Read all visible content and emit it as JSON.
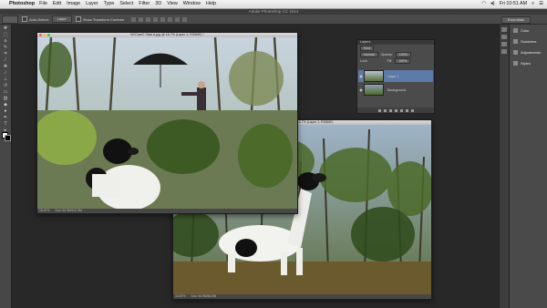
{
  "menubar": {
    "app": "Photoshop",
    "items": [
      "File",
      "Edit",
      "Image",
      "Layer",
      "Type",
      "Select",
      "Filter",
      "3D",
      "View",
      "Window",
      "Help"
    ],
    "clock": "Fri 10:51 AM"
  },
  "window_title": "Adobe Photoshop CC 2014",
  "options_bar": {
    "auto_select": "Auto-Select:",
    "auto_select_target": "Layer",
    "show_transform": "Show Transform Controls",
    "workspace": "Essentials"
  },
  "documents": [
    {
      "title": "NYCareC Start A.jpg @ 16.7% (Layer 1, RGB/8*) *",
      "zoom": "16.67%",
      "doc_size": "Doc: 54.9M/112.3M"
    },
    {
      "title": "MCDE Ex.psd @ 16.7% (Layer 1, RGB/8*)",
      "zoom": "16.67%",
      "doc_size": "Doc: 54.9M/54.9M"
    }
  ],
  "layers_panel": {
    "title": "Layers",
    "filter": "Kind",
    "blend_mode": "Normal",
    "opacity_label": "Opacity:",
    "opacity": "100%",
    "lock_label": "Lock:",
    "fill_label": "Fill:",
    "fill": "100%",
    "layers": [
      {
        "name": "Layer 1",
        "selected": true
      },
      {
        "name": "Background",
        "selected": false
      }
    ]
  },
  "right_panels": [
    "Color",
    "Swatches",
    "Adjustments",
    "Styles"
  ],
  "colors": {
    "accent_selected": "#5d7aa8",
    "ui_background": "#282828",
    "panel": "#4a4a4a"
  }
}
